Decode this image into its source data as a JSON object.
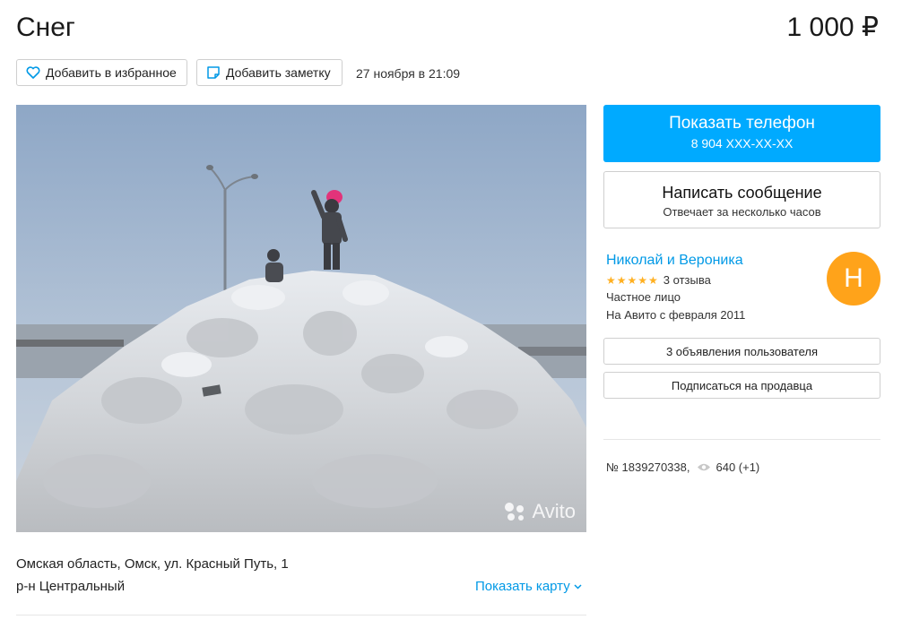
{
  "header": {
    "title": "Снег",
    "price": "1 000 ₽"
  },
  "actions": {
    "favorite_label": "Добавить в избранное",
    "note_label": "Добавить заметку",
    "date": "27 ноября в 21:09"
  },
  "photo": {
    "watermark": "Avito",
    "subject": "snow-pile-with-children"
  },
  "contact": {
    "phone_title": "Показать телефон",
    "phone_number": "8 904 XXX-XX-XX",
    "message_title": "Написать сообщение",
    "message_sub": "Отвечает за несколько часов"
  },
  "seller": {
    "name": "Николай и Вероника",
    "stars": "★★★★★",
    "reviews": "3 отзыва",
    "type": "Частное лицо",
    "since": "На Авито с февраля 2011",
    "avatar_letter": "Н",
    "listings_label": "3 объявления пользователя",
    "subscribe_label": "Подписаться на продавца"
  },
  "meta": {
    "ad_number": "№ 1839270338,",
    "views": "640 (+1)"
  },
  "location": {
    "address": "Омская область, Омск, ул. Красный Путь, 1",
    "district": "р-н Центральный",
    "map_link": "Показать карту"
  },
  "colors": {
    "accent": "#00aaff",
    "link": "#0099e6",
    "avatar": "#ffa31a",
    "stars": "#ffb021"
  },
  "icons": [
    "heart-icon",
    "note-icon",
    "eye-icon",
    "chevron-down-icon"
  ]
}
